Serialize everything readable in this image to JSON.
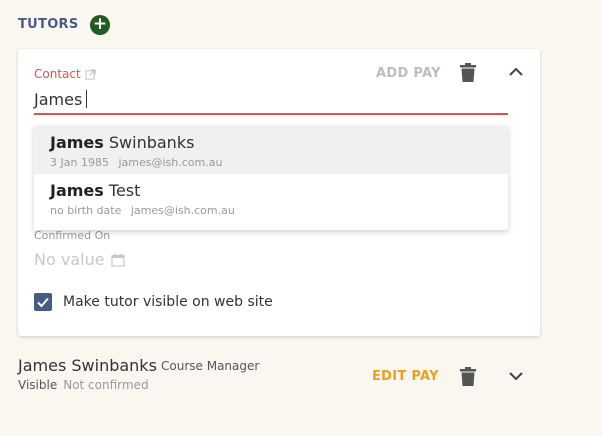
{
  "section": {
    "title": "TUTORS"
  },
  "card": {
    "contact_label": "Contact",
    "add_pay_label": "ADD PAY",
    "input_value": "James",
    "suggestions": [
      {
        "bold": "James",
        "rest": "Swinbanks",
        "birth": "3 Jan 1985",
        "email": "james@ish.com.au"
      },
      {
        "bold": "James",
        "rest": "Test",
        "birth": "no birth date",
        "email": "james@ish.com.au"
      }
    ],
    "confirmed_label": "Confirmed On",
    "confirmed_value": "No value",
    "visible_checkbox_label": "Make tutor visible on web site",
    "visible_checked": true
  },
  "tutor_row": {
    "name": "James Swinbanks",
    "role": "Course Manager",
    "status": "Visible",
    "confirmation": "Not confirmed",
    "edit_pay_label": "EDIT PAY"
  },
  "colors": {
    "accent": "#4a5a86",
    "error": "#d9534f",
    "add_button": "#1f5b22",
    "edit_pay": "#e8a020"
  }
}
